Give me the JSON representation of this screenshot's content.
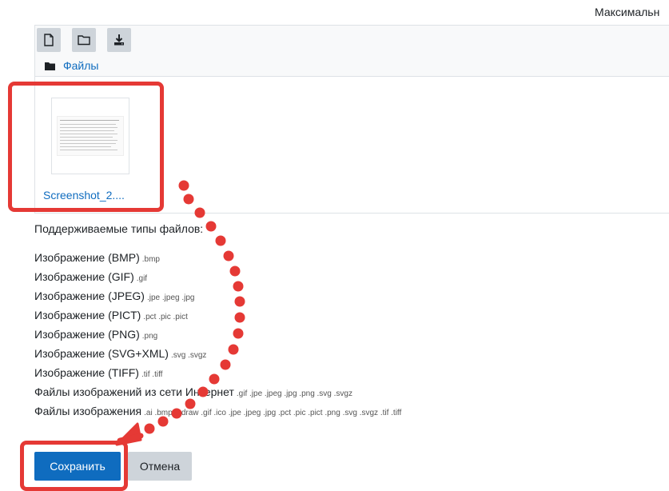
{
  "header": {
    "max_size_label": "Максимальн"
  },
  "toolbar": {
    "buttons": [
      {
        "icon": "file-icon"
      },
      {
        "icon": "folder-icon"
      },
      {
        "icon": "download-icon"
      }
    ]
  },
  "breadcrumb": {
    "icon": "folder-solid-icon",
    "label": "Файлы"
  },
  "files": [
    {
      "name": "Screenshot_2....",
      "icon": "image-thumbnail"
    }
  ],
  "supported_types": {
    "title": "Поддерживаемые типы файлов:",
    "items": [
      {
        "label": "Изображение (BMP)",
        "ext": ".bmp"
      },
      {
        "label": "Изображение (GIF)",
        "ext": ".gif"
      },
      {
        "label": "Изображение (JPEG)",
        "ext": ".jpe .jpeg .jpg"
      },
      {
        "label": "Изображение (PICT)",
        "ext": ".pct .pic .pict"
      },
      {
        "label": "Изображение (PNG)",
        "ext": ".png"
      },
      {
        "label": "Изображение (SVG+XML)",
        "ext": ".svg .svgz"
      },
      {
        "label": "Изображение (TIFF)",
        "ext": ".tif .tiff"
      },
      {
        "label": "Файлы изображений из сети Интернет",
        "ext": ".gif .jpe .jpeg .jpg .png .svg .svgz"
      },
      {
        "label": "Файлы изображения",
        "ext": ".ai .bmp .gdraw .gif .ico .jpe .jpeg .jpg .pct .pic .pict .png .svg .svgz .tif .tiff"
      }
    ]
  },
  "actions": {
    "save_label": "Сохранить",
    "cancel_label": "Отмена"
  },
  "colors": {
    "primary": "#0f6cbf",
    "highlight": "#e53935",
    "secondary_button": "#ced4da"
  }
}
